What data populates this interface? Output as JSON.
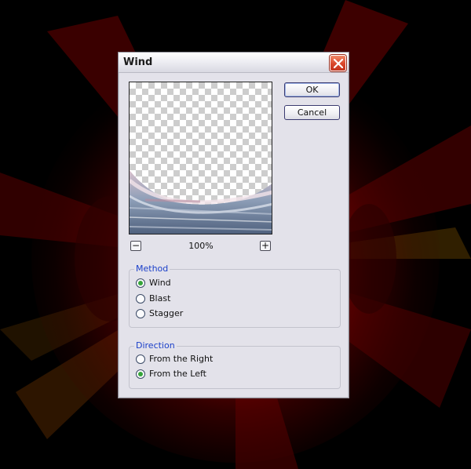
{
  "window": {
    "title": "Wind",
    "close_icon": "close-icon"
  },
  "preview": {
    "zoom_level": "100%",
    "zoom_out_label": "−",
    "zoom_in_label": "+"
  },
  "buttons": {
    "ok_label": "OK",
    "cancel_label": "Cancel"
  },
  "method": {
    "legend": "Method",
    "options": [
      {
        "label": "Wind",
        "selected": true
      },
      {
        "label": "Blast",
        "selected": false
      },
      {
        "label": "Stagger",
        "selected": false
      }
    ]
  },
  "direction": {
    "legend": "Direction",
    "options": [
      {
        "label": "From the Right",
        "selected": false
      },
      {
        "label": "From the Left",
        "selected": true
      }
    ]
  },
  "colors": {
    "dialog_bg": "#e3e2ea",
    "legend_text": "#1a3fc9",
    "radio_dot": "#35a43a",
    "close_button": "#d9462a",
    "background_red": "#8c0000"
  }
}
